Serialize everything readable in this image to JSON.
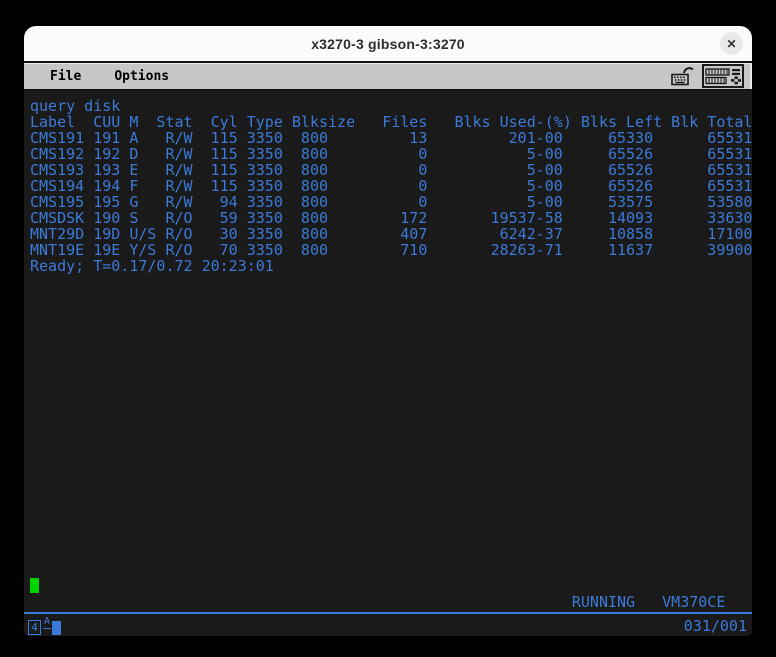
{
  "window": {
    "title": "x3270-3 gibson-3:3270",
    "close_glyph": "✕"
  },
  "menubar": {
    "items": [
      {
        "label": "File"
      },
      {
        "label": "Options"
      }
    ],
    "icons": [
      {
        "name": "keyboard-unlock-icon"
      },
      {
        "name": "keypad-icon"
      }
    ]
  },
  "terminal": {
    "columns": 80,
    "visible_rows": 32,
    "rows": [
      "query disk",
      "Label  CUU M  Stat  Cyl Type Blksize   Files   Blks Used-(%) Blks Left Blk Total",
      "CMS191 191 A   R/W  115 3350  800         13         201-00     65330      65531",
      "CMS192 192 D   R/W  115 3350  800          0           5-00     65526      65531",
      "CMS193 193 E   R/W  115 3350  800          0           5-00     65526      65531",
      "CMS194 194 F   R/W  115 3350  800          0           5-00     65526      65531",
      "CMS195 195 G   R/W   94 3350  800          0           5-00     53575      53580",
      "CMSDSK 190 S   R/O   59 3350  800        172       19537-58     14093      33630",
      "MNT29D 19D U/S R/O   30 3350  800        407        6242-37     10858      17100",
      "MNT19E 19E Y/S R/O   70 3350  800        710       28263-71     11637      39900",
      "Ready; T=0.17/0.72 20:23:01",
      "",
      "",
      "",
      "",
      "",
      "",
      "",
      "",
      "",
      "",
      "",
      "",
      "",
      "",
      "",
      "",
      "",
      "",
      "",
      "",
      "                                                            RUNNING   VM370CE"
    ],
    "cursor": {
      "row": 31,
      "col": 1
    },
    "status_text": "RUNNING",
    "system_id": "VM370CE"
  },
  "oia": {
    "connection_indicator": "4",
    "mode_indicator": "A",
    "cursor_position": "031/001"
  },
  "colors": {
    "terminal_text": "#3b7ad8",
    "terminal_bg": "#1a1a1a",
    "cursor_green": "#00d400",
    "menubar_gray": "#c7c7c7",
    "headerbar_white": "#fbfbfb"
  }
}
